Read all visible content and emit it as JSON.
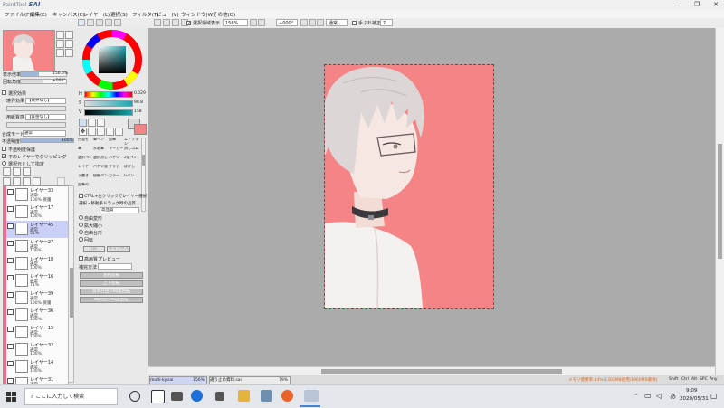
{
  "app": {
    "logo_prefix": "PaintTool",
    "logo_name": "SAI",
    "window_buttons": [
      "—",
      "❐",
      "✕"
    ]
  },
  "menu": [
    "ファイル(F)",
    "編集(E)",
    "キャンバス(C)",
    "レイヤー(L)",
    "選択(S)",
    "フィルタ(T)",
    "ビュー(V)",
    "ウィンドウ(W)",
    "その他(O)"
  ],
  "toolbar": {
    "selection_toggle_label": "選択領域表示",
    "zoom_value": "156%",
    "rotation_value": "+000°",
    "blend_label": "通常",
    "stabilizer_label": "手ぶれ補正",
    "stabilizer_value": "7"
  },
  "navigator": {
    "zoom_label": "表示倍率",
    "zoom_value": "156.0%",
    "angle_label": "回転角度",
    "angle_value": "+000°"
  },
  "color": {
    "current": "#f58486",
    "h_value": "0.029",
    "s_value": "90.8",
    "v_value": "158",
    "labels": [
      "H",
      "S",
      "V"
    ]
  },
  "selection_effects": {
    "section_label": "選択効果",
    "edge_label": "境界効果",
    "edge_value": "【境界なし】",
    "texture_label": "用紙質感",
    "texture_value": "【質感なし】"
  },
  "layer_panel": {
    "blend_mode_label": "合成モード",
    "blend_mode_value": "通常",
    "opacity_label": "不透明度",
    "opacity_value": "100%",
    "options": [
      "不透明度保護",
      "下のレイヤーでクリッピング",
      "選択元として指定"
    ],
    "layers": [
      {
        "name": "レイヤー33",
        "mode": "通常",
        "opacity": "100% 保護",
        "selected": false
      },
      {
        "name": "レイヤー17",
        "mode": "通常",
        "opacity": "100%",
        "selected": false
      },
      {
        "name": "レイヤー45",
        "mode": "通常",
        "opacity": "51%",
        "selected": true
      },
      {
        "name": "レイヤー27",
        "mode": "通常",
        "opacity": "100%",
        "selected": false
      },
      {
        "name": "レイヤー18",
        "mode": "通常",
        "opacity": "100%",
        "selected": false
      },
      {
        "name": "レイヤー16",
        "mode": "通常",
        "opacity": "71%",
        "selected": false
      },
      {
        "name": "レイヤー39",
        "mode": "通常",
        "opacity": "100% 保護",
        "selected": false
      },
      {
        "name": "レイヤー36",
        "mode": "通常",
        "opacity": "100%",
        "selected": false
      },
      {
        "name": "レイヤー15",
        "mode": "通常",
        "opacity": "100%",
        "selected": false
      },
      {
        "name": "レイヤー32",
        "mode": "通常",
        "opacity": "100%",
        "selected": false
      },
      {
        "name": "レイヤー14",
        "mode": "通常",
        "opacity": "100%",
        "selected": false
      },
      {
        "name": "レイヤー31",
        "mode": "通常",
        "opacity": "",
        "selected": false
      }
    ]
  },
  "tools": {
    "brushes": [
      "色混ぜ",
      "筆ペン",
      "鉛筆",
      "エアブラシ",
      "筆",
      "水彩筆",
      "マーカー",
      "消しゴム",
      "選択ペン",
      "選択消し",
      "バケツ",
      "2値ペン",
      "レイヤー",
      "バケツ塗",
      "グラデ",
      "ぼかし",
      "下書き",
      "極細ペン",
      "カラー",
      "Gペン",
      "鉛筆の"
    ],
    "ctrl_label": "CTRL+左クリックでレイヤー選択",
    "transform_label": "選択・移動系ドラッグ時の品質",
    "transform_value": "高品質",
    "modes": [
      "自由変形",
      "拡大縮小",
      "自由台形",
      "回転"
    ],
    "buttons": [
      "OK",
      "キャンセル"
    ],
    "preview_label": "高画質プレビュー",
    "quality_label": "補完方法",
    "flip_buttons": [
      "左右反転",
      "上下反転",
      "反時計回り90度回転",
      "時計回り90度回転"
    ]
  },
  "doc_tabs": [
    {
      "name": "multi-ky.sai",
      "zoom": "156%",
      "active": true
    },
    {
      "name": "違う止め資料.sai",
      "zoom": "79%",
      "active": false
    }
  ],
  "status": {
    "memory": "メモリ使用率:44%(1303MB使用/1900MB確保)",
    "keys": [
      "Shift",
      "Ctrl",
      "Alt",
      "SPC",
      "Any"
    ]
  },
  "taskbar": {
    "search_placeholder": "ここに入力して検索",
    "time": "9:09",
    "date": "2020/05/31",
    "ime": "あ"
  }
}
